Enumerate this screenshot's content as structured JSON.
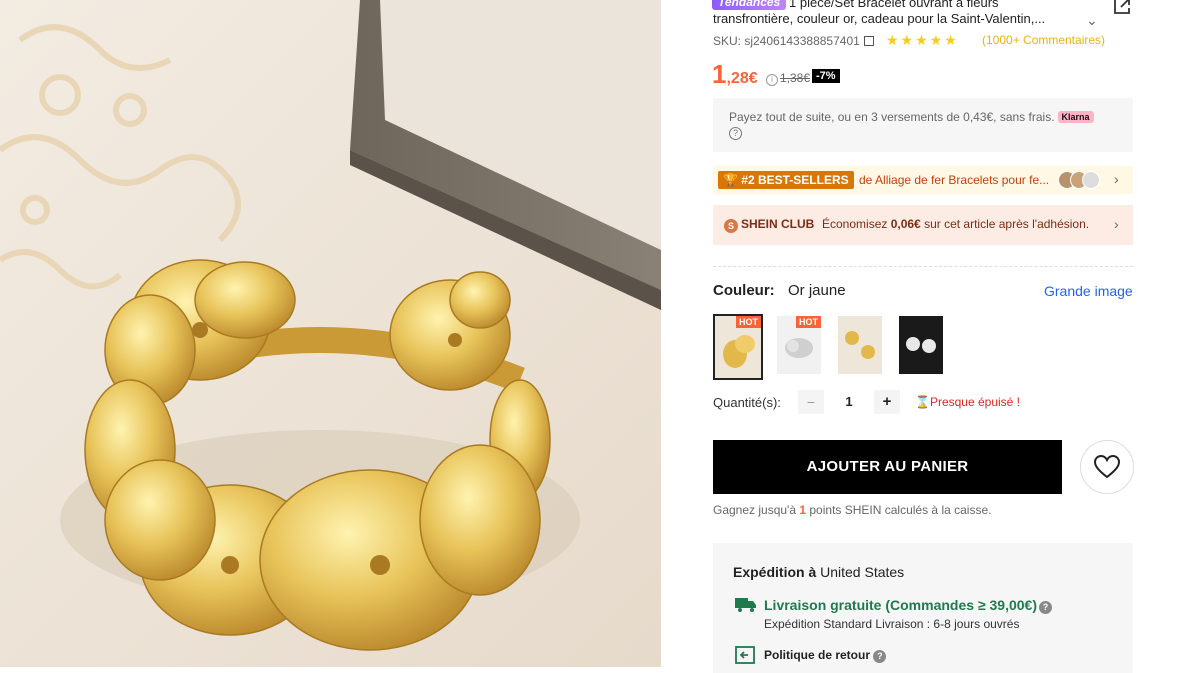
{
  "product": {
    "trend_badge": "Tendances",
    "title_line1": "1 pièce/Set Bracelet ouvrant à fleurs",
    "title_line2": "transfrontière, couleur or, cadeau pour la Saint-Valentin,...",
    "sku": "SKU: sj2406143388857401",
    "rating_stars": "★★★★★",
    "rating_value": 4.5,
    "reviews": "(1000+ Commentaires)"
  },
  "price": {
    "whole": "1",
    "fraction": ",28€",
    "old_price": "1,38€",
    "discount": "-7%"
  },
  "klarna": {
    "text": "Payez tout de suite, ou en 3 versements de 0,43€, sans frais.",
    "badge": "Klarna",
    "help": "?"
  },
  "bestseller": {
    "tag": "#2 BEST-SELLERS",
    "text": "de Alliage de fer Bracelets pour fe..."
  },
  "club": {
    "logo": "SHEIN CLUB",
    "text_prefix": "Économisez ",
    "amount": "0,06€",
    "text_suffix": " sur cet article après l'adhésion."
  },
  "color": {
    "label": "Couleur:",
    "value": "Or jaune",
    "grande_image": "Grande image",
    "hot_label": "HOT"
  },
  "quantity": {
    "label": "Quantité(s):",
    "minus": "−",
    "value": "1",
    "plus": "+",
    "stock_warning": "Presque épuisé !"
  },
  "cart": {
    "add_label": "AJOUTER AU PANIER",
    "points_prefix": "Gagnez jusqu'à ",
    "points_value": "1",
    "points_suffix": " points SHEIN calculés à la caisse."
  },
  "shipping": {
    "title_prefix": "Expédition à",
    "destination": "United States",
    "free_label": "Livraison gratuite (Commandes ≥ 39,00€)",
    "standard": "Expédition Standard Livraison : 6-8 jours ouvrés",
    "return_policy": "Politique de retour"
  },
  "colors": {
    "price": "#fa6338",
    "free_shipping": "#1f7a4d",
    "cta": "#000000",
    "stock": "#dc2626",
    "link": "#2563eb"
  }
}
